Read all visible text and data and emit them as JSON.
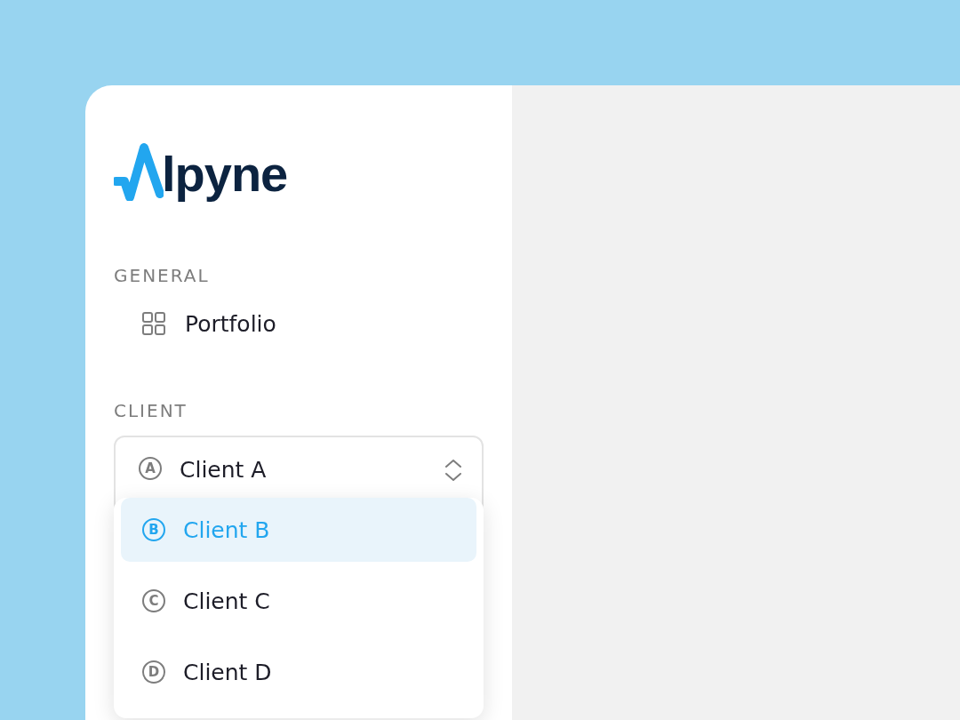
{
  "logo": {
    "text": "lpyne"
  },
  "sections": [
    {
      "title": "GENERAL",
      "items": [
        {
          "label": "Portfolio"
        }
      ]
    },
    {
      "title": "CLIENT"
    }
  ],
  "client_select": {
    "value": {
      "initial": "A",
      "label": "Client A"
    },
    "expanded": true,
    "options": [
      {
        "initial": "B",
        "label": "Client B",
        "selected": true
      },
      {
        "initial": "C",
        "label": "Client C",
        "selected": false
      },
      {
        "initial": "D",
        "label": "Client D",
        "selected": false
      }
    ]
  }
}
